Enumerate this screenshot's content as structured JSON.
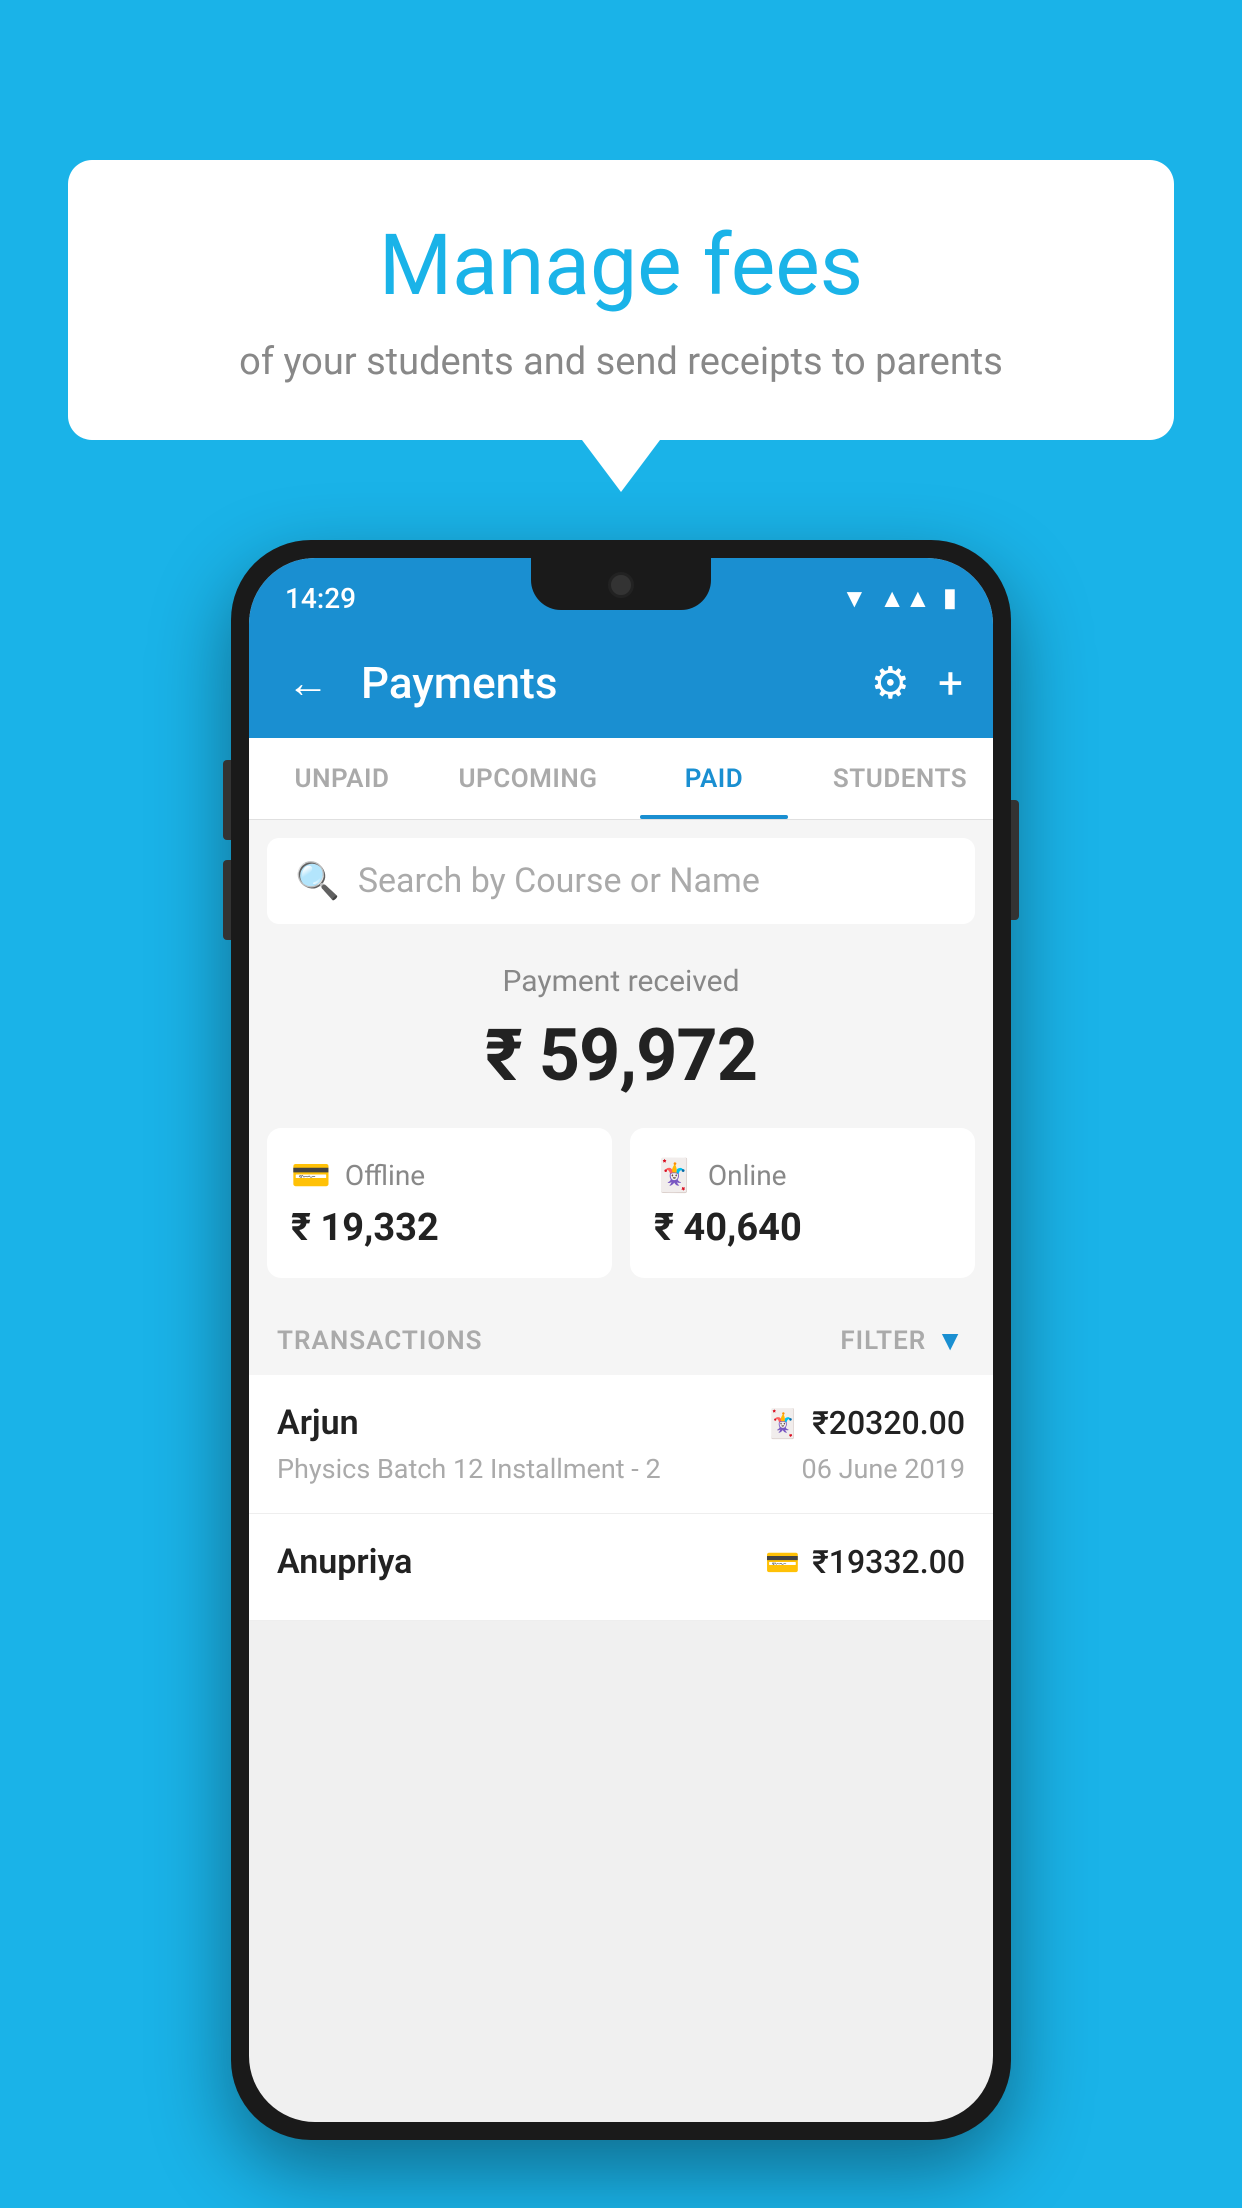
{
  "background_color": "#1ab3e8",
  "bubble": {
    "title": "Manage fees",
    "subtitle": "of your students and send receipts to parents"
  },
  "status_bar": {
    "time": "14:29",
    "wifi": "▼",
    "signal": "▲",
    "battery": "▮"
  },
  "app_bar": {
    "title": "Payments",
    "back_label": "←",
    "gear_label": "⚙",
    "plus_label": "+"
  },
  "tabs": [
    {
      "label": "UNPAID",
      "active": false
    },
    {
      "label": "UPCOMING",
      "active": false
    },
    {
      "label": "PAID",
      "active": true
    },
    {
      "label": "STUDENTS",
      "active": false
    }
  ],
  "search": {
    "placeholder": "Search by Course or Name"
  },
  "payment_summary": {
    "label": "Payment received",
    "amount": "₹ 59,972"
  },
  "payment_cards": [
    {
      "icon": "💳",
      "label": "Offline",
      "amount": "₹ 19,332"
    },
    {
      "icon": "🃏",
      "label": "Online",
      "amount": "₹ 40,640"
    }
  ],
  "transactions_header": {
    "label": "TRANSACTIONS",
    "filter_label": "FILTER"
  },
  "transactions": [
    {
      "name": "Arjun",
      "detail": "Physics Batch 12 Installment - 2",
      "amount": "₹20320.00",
      "date": "06 June 2019",
      "type_icon": "🃏"
    },
    {
      "name": "Anupriya",
      "detail": "",
      "amount": "₹19332.00",
      "date": "",
      "type_icon": "💳"
    }
  ]
}
